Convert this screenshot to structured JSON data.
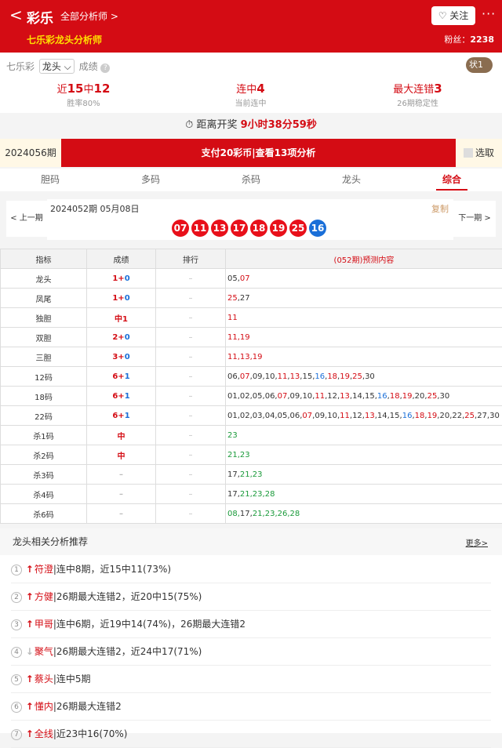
{
  "header": {
    "back_label": "<",
    "title": "彩乐",
    "all_link": "全部分析师 >",
    "subtitle": "七乐彩龙头分析师",
    "follow": "♡ 关注",
    "more": "···",
    "fans_label": "粉丝：",
    "fans": "2238"
  },
  "stats": {
    "lottery": "七乐彩",
    "select": "龙头 ⌵",
    "grade": "成绩",
    "help": "?",
    "badge": "状1",
    "cols": [
      {
        "prefix": "近",
        "a": "15",
        "mid": "中",
        "b": "12",
        "sub": "胜率80%"
      },
      {
        "prefix": "连中",
        "a": "4",
        "mid": "",
        "b": "",
        "sub": "当前连中"
      },
      {
        "prefix": "最大连错",
        "a": "3",
        "mid": "",
        "b": "",
        "sub": "26期稳定性"
      }
    ]
  },
  "countdown": {
    "label": "距离开奖",
    "time": "9小时38分59秒"
  },
  "pay": {
    "period": "2024056期",
    "button": "支付20彩币|查看13项分析",
    "pick": "选取"
  },
  "tabs": [
    "胆码",
    "多码",
    "杀码",
    "龙头",
    "综合"
  ],
  "draw": {
    "prev": "< 上一期",
    "next": "下一期 >",
    "issue": "2024052期 05月08日",
    "copy": "复制",
    "red": [
      "07",
      "11",
      "13",
      "17",
      "18",
      "19",
      "25"
    ],
    "blue": "16"
  },
  "table": {
    "headers": [
      "指标",
      "成绩",
      "排行",
      "(052期)预测内容"
    ],
    "rows": [
      {
        "k": "龙头",
        "r": [
          [
            "1",
            "r"
          ],
          [
            "+",
            ""
          ],
          [
            "0",
            "b"
          ]
        ],
        "rank": "–",
        "c": [
          [
            "05,",
            ""
          ],
          [
            "07",
            "r"
          ]
        ]
      },
      {
        "k": "凤尾",
        "r": [
          [
            "1",
            "r"
          ],
          [
            "+",
            ""
          ],
          [
            "0",
            "b"
          ]
        ],
        "rank": "–",
        "c": [
          [
            "25",
            "r"
          ],
          [
            ",27",
            ""
          ]
        ]
      },
      {
        "k": "独胆",
        "r": [
          [
            "中1",
            "r"
          ]
        ],
        "rank": "–",
        "c": [
          [
            "11",
            "r"
          ]
        ]
      },
      {
        "k": "双胆",
        "r": [
          [
            "2",
            "r"
          ],
          [
            "+",
            ""
          ],
          [
            "0",
            "b"
          ]
        ],
        "rank": "–",
        "c": [
          [
            "11,19",
            "r"
          ]
        ]
      },
      {
        "k": "三胆",
        "r": [
          [
            "3",
            "r"
          ],
          [
            "+",
            ""
          ],
          [
            "0",
            "b"
          ]
        ],
        "rank": "–",
        "c": [
          [
            "11,13,19",
            "r"
          ]
        ]
      },
      {
        "k": "12码",
        "r": [
          [
            "6",
            "r"
          ],
          [
            "+",
            ""
          ],
          [
            "1",
            "b"
          ]
        ],
        "rank": "–",
        "c": [
          [
            "06,",
            ""
          ],
          [
            "07",
            "r"
          ],
          [
            ",09,10,",
            ""
          ],
          [
            "11",
            "r"
          ],
          [
            ",",
            ""
          ],
          [
            "13",
            "r"
          ],
          [
            ",15,",
            ""
          ],
          [
            "16",
            "b"
          ],
          [
            ",",
            ""
          ],
          [
            "18",
            "r"
          ],
          [
            ",",
            ""
          ],
          [
            "19",
            "r"
          ],
          [
            ",",
            ""
          ],
          [
            "25",
            "r"
          ],
          [
            ",30",
            ""
          ]
        ]
      },
      {
        "k": "18码",
        "r": [
          [
            "6",
            "r"
          ],
          [
            "+",
            ""
          ],
          [
            "1",
            "b"
          ]
        ],
        "rank": "–",
        "c": [
          [
            "01,02,05,06,",
            ""
          ],
          [
            "07",
            "r"
          ],
          [
            ",09,10,",
            ""
          ],
          [
            "11",
            "r"
          ],
          [
            ",12,",
            ""
          ],
          [
            "13",
            "r"
          ],
          [
            ",14,15,",
            ""
          ],
          [
            "16",
            "b"
          ],
          [
            ",",
            ""
          ],
          [
            "18",
            "r"
          ],
          [
            ",",
            ""
          ],
          [
            "19",
            "r"
          ],
          [
            ",20,",
            ""
          ],
          [
            "25",
            "r"
          ],
          [
            ",30",
            ""
          ]
        ]
      },
      {
        "k": "22码",
        "r": [
          [
            "6",
            "r"
          ],
          [
            "+",
            ""
          ],
          [
            "1",
            "b"
          ]
        ],
        "rank": "–",
        "c": [
          [
            "01,02,03,04,05,06,",
            ""
          ],
          [
            "07",
            "r"
          ],
          [
            ",09,10,",
            ""
          ],
          [
            "11",
            "r"
          ],
          [
            ",12,",
            ""
          ],
          [
            "13",
            "r"
          ],
          [
            ",14,15,",
            ""
          ],
          [
            "16",
            "b"
          ],
          [
            ",",
            ""
          ],
          [
            "18",
            "r"
          ],
          [
            ",",
            ""
          ],
          [
            "19",
            "r"
          ],
          [
            ",20,22,",
            ""
          ],
          [
            "25",
            "r"
          ],
          [
            ",27,30",
            ""
          ]
        ]
      },
      {
        "k": "杀1码",
        "r": [
          [
            "中",
            "r"
          ]
        ],
        "rank": "–",
        "c": [
          [
            "23",
            "g"
          ]
        ]
      },
      {
        "k": "杀2码",
        "r": [
          [
            "中",
            "r"
          ]
        ],
        "rank": "–",
        "c": [
          [
            "21,23",
            "g"
          ]
        ]
      },
      {
        "k": "杀3码",
        "r": [
          [
            "–",
            "y"
          ]
        ],
        "rank": "–",
        "c": [
          [
            "17,",
            ""
          ],
          [
            "21,23",
            "g"
          ]
        ]
      },
      {
        "k": "杀4码",
        "r": [
          [
            "–",
            "y"
          ]
        ],
        "rank": "–",
        "c": [
          [
            "17,",
            ""
          ],
          [
            "21,23,28",
            "g"
          ]
        ]
      },
      {
        "k": "杀6码",
        "r": [
          [
            "–",
            "y"
          ]
        ],
        "rank": "–",
        "c": [
          [
            "08,",
            "g"
          ],
          [
            "17,",
            ""
          ],
          [
            "21,23,26,28",
            "g"
          ]
        ]
      }
    ]
  },
  "recommend": {
    "title": "龙头相关分析推荐",
    "more": "更多>",
    "items": [
      {
        "n": "1",
        "dir": "up",
        "name": "符澄",
        "detail": "|连中8期，近15中11(73%)"
      },
      {
        "n": "2",
        "dir": "up",
        "name": "方健",
        "detail": "|26期最大连错2，近20中15(75%)"
      },
      {
        "n": "3",
        "dir": "up",
        "name": "甲哥",
        "detail": "|连中6期，近19中14(74%)，26期最大连错2"
      },
      {
        "n": "4",
        "dir": "dn",
        "name": "聚气",
        "detail": "|26期最大连错2，近24中17(71%)"
      },
      {
        "n": "5",
        "dir": "up",
        "name": "蔡头",
        "detail": "|连中5期"
      },
      {
        "n": "6",
        "dir": "up",
        "name": "懂内",
        "detail": "|26期最大连错2"
      },
      {
        "n": "7",
        "dir": "up",
        "name": "全线",
        "detail": "|近23中16(70%)"
      }
    ]
  }
}
